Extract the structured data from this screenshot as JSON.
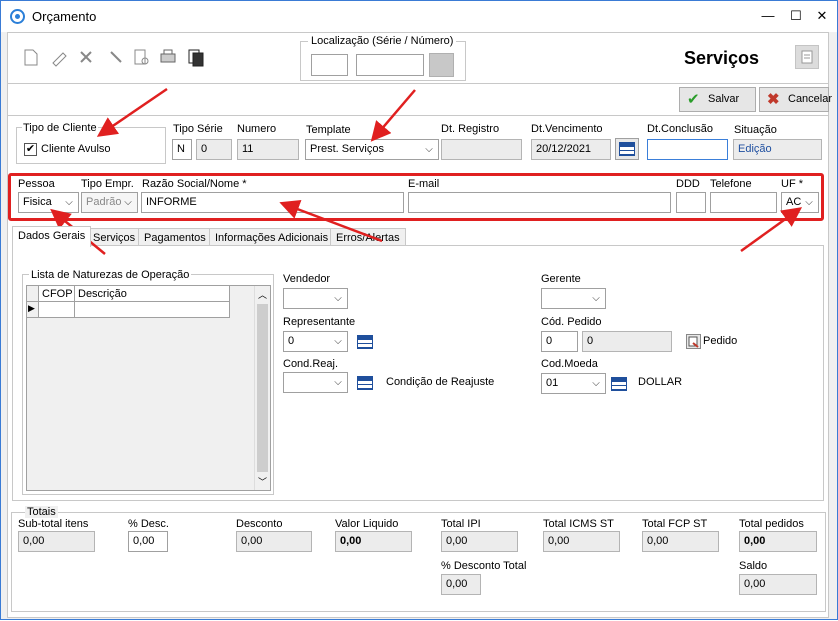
{
  "window": {
    "title": "Orçamento",
    "min": "—",
    "max": "☐",
    "close": "✕"
  },
  "toolbar": {
    "localizacao_label": "Localização (Série / Número)",
    "module_title": "Serviços"
  },
  "actions": {
    "save_label": "Salvar",
    "cancel_label": "Cancelar"
  },
  "header": {
    "tipo_cliente_label": "Tipo de Cliente",
    "cliente_avulso_label": "Cliente Avulso",
    "cliente_avulso_checked": "✔",
    "tipo_serie_label": "Tipo Série",
    "tipo_value": "N",
    "serie_value": "0",
    "numero_label": "Numero",
    "numero_value": "11",
    "template_label": "Template",
    "template_value": "Prest. Serviços",
    "dt_registro_label": "Dt. Registro",
    "dt_registro_value": "",
    "dt_vencimento_label": "Dt.Vencimento",
    "dt_vencimento_value": "20/12/2021",
    "dt_conclusao_label": "Dt.Conclusão",
    "dt_conclusao_value": "",
    "situacao_label": "Situação",
    "situacao_value": "Edição"
  },
  "cliente": {
    "pessoa_label": "Pessoa",
    "pessoa_value": "Fisica",
    "tipo_empr_label": "Tipo Empr.",
    "tipo_empr_value": "Padrão",
    "razao_label": "Razão Social/Nome *",
    "razao_value": "INFORME",
    "email_label": "E-mail",
    "email_value": "",
    "ddd_label": "DDD",
    "ddd_value": "",
    "telefone_label": "Telefone",
    "telefone_value": "",
    "uf_label": "UF *",
    "uf_value": "AC"
  },
  "tabs": [
    {
      "label": "Dados Gerais"
    },
    {
      "label": "Serviços"
    },
    {
      "label": "Pagamentos"
    },
    {
      "label": "Informações Adicionais"
    },
    {
      "label": "Erros/Alertas"
    }
  ],
  "dados_gerais": {
    "naturezas_label": "Lista de Naturezas de Operação",
    "grid_columns": [
      "CFOP",
      "Descrição"
    ],
    "row_indicator": "▶",
    "vendedor_label": "Vendedor",
    "vendedor_value": "",
    "representante_label": "Representante",
    "representante_value": "0",
    "cond_reaj_label": "Cond.Reaj.",
    "cond_reaj_value": "",
    "condicao_reajuste_text": "Condição de Reajuste",
    "gerente_label": "Gerente",
    "gerente_value": "",
    "cod_pedido_label": "Cód. Pedido",
    "cod_pedido_a": "0",
    "cod_pedido_b": "0",
    "pedido_label": "Pedido",
    "cod_moeda_label": "Cod.Moeda",
    "cod_moeda_value": "01",
    "moeda_name": "DOLLAR"
  },
  "totais": {
    "label": "Totais",
    "subtotal_label": "Sub-total itens",
    "subtotal_value": "0,00",
    "pct_desc_label": "% Desc.",
    "pct_desc_value": "0,00",
    "desconto_label": "Desconto",
    "desconto_value": "0,00",
    "valor_liquido_label": "Valor Liquido",
    "valor_liquido_value": "0,00",
    "total_ipi_label": "Total IPI",
    "total_ipi_value": "0,00",
    "total_icms_st_label": "Total ICMS ST",
    "total_icms_st_value": "0,00",
    "total_fcp_st_label": "Total FCP ST",
    "total_fcp_st_value": "0,00",
    "total_pedidos_label": "Total pedidos",
    "total_pedidos_value": "0,00",
    "pct_desc_total_label": "% Desconto Total",
    "pct_desc_total_value": "0,00",
    "saldo_label": "Saldo",
    "saldo_value": "0,00"
  },
  "colors": {
    "annotation_red": "#e02020",
    "save_green": "#2a9d2a",
    "cancel_red": "#c0392b"
  }
}
